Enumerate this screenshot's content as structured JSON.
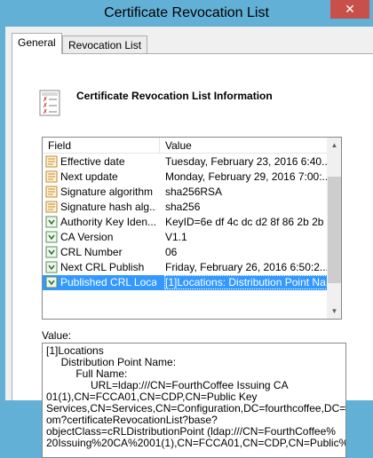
{
  "window": {
    "title": "Certificate Revocation List",
    "close_glyph": "✕"
  },
  "tabs": [
    {
      "label": "General",
      "active": true
    },
    {
      "label": "Revocation List",
      "active": false
    }
  ],
  "header": {
    "icon": "certificate-list-icon",
    "title": "Certificate Revocation List Information"
  },
  "list": {
    "columns": {
      "field": "Field",
      "value": "Value"
    },
    "rows": [
      {
        "field": "Effective date",
        "value": "Tuesday, February 23, 2016 6:40...",
        "icon": "document-icon"
      },
      {
        "field": "Next update",
        "value": "Monday, February 29, 2016 7:00:...",
        "icon": "document-icon"
      },
      {
        "field": "Signature algorithm",
        "value": "sha256RSA",
        "icon": "document-icon"
      },
      {
        "field": "Signature hash alg...",
        "value": "sha256",
        "icon": "document-icon"
      },
      {
        "field": "Authority Key Iden...",
        "value": "KeyID=6e df 4c dc d2 8f 86 2b 2b ...",
        "icon": "extension-icon"
      },
      {
        "field": "CA Version",
        "value": "V1.1",
        "icon": "extension-icon"
      },
      {
        "field": "CRL Number",
        "value": "06",
        "icon": "extension-icon"
      },
      {
        "field": "Next CRL Publish",
        "value": "Friday, February 26, 2016 6:50:2...",
        "icon": "extension-icon"
      },
      {
        "field": "Published CRL Loca...",
        "value": "[1]Locations: Distribution Point Na...",
        "icon": "extension-icon",
        "selected": true
      }
    ]
  },
  "value_label": "Value:",
  "value_text": "[1]Locations\n     Distribution Point Name:\n          Full Name:\n               URL=ldap:///CN=FourthCoffee Issuing CA\n01(1),CN=FCCA01,CN=CDP,CN=Public Key\nServices,CN=Services,CN=Configuration,DC=fourthcoffee,DC=c\nom?certificateRevocationList?base?\nobjectClass=cRLDistributionPoint (ldap:///CN=FourthCoffee%\n20Issuing%20CA%2001(1),CN=FCCA01,CN=CDP,CN=Public%"
}
